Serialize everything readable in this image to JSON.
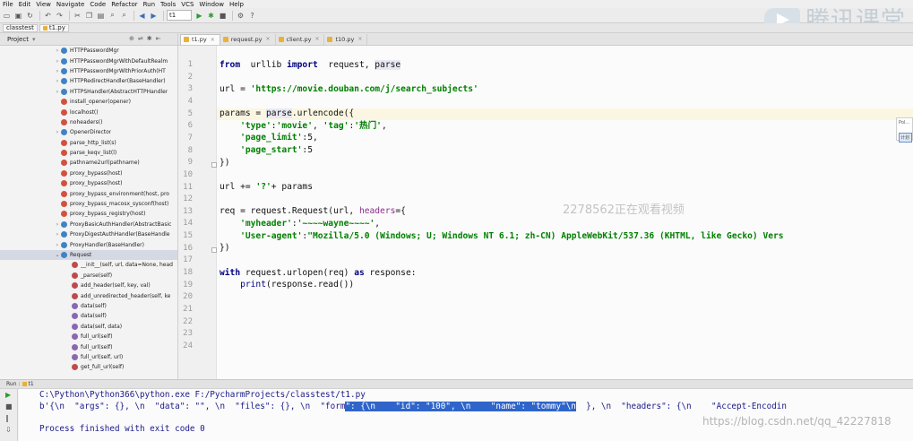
{
  "menu": [
    "File",
    "Edit",
    "View",
    "Navigate",
    "Code",
    "Refactor",
    "Run",
    "Tools",
    "VCS",
    "Window",
    "Help"
  ],
  "toolbar": {
    "run_config": "t1"
  },
  "logo": {
    "text": "腾讯课堂"
  },
  "breadcrumb": [
    "classtest",
    "t1.py"
  ],
  "project": {
    "title": "Project",
    "items": [
      {
        "label": "HTTPPasswordMgr",
        "icon": "class",
        "arrow": "›",
        "indent": 1
      },
      {
        "label": "HTTPPasswordMgrWithDefaultRealm",
        "icon": "class",
        "arrow": "›",
        "indent": 1
      },
      {
        "label": "HTTPPasswordMgrWithPriorAuth(HT",
        "icon": "class",
        "arrow": "›",
        "indent": 1
      },
      {
        "label": "HTTPRedirectHandler(BaseHandler)",
        "icon": "class",
        "arrow": "›",
        "indent": 1
      },
      {
        "label": "HTTPSHandler(AbstractHTTPHandler",
        "icon": "class",
        "arrow": "›",
        "indent": 1
      },
      {
        "label": "install_opener(opener)",
        "icon": "function",
        "arrow": "",
        "indent": 1
      },
      {
        "label": "localhost()",
        "icon": "function",
        "arrow": "",
        "indent": 1
      },
      {
        "label": "noheaders()",
        "icon": "function",
        "arrow": "",
        "indent": 1
      },
      {
        "label": "OpenerDirector",
        "icon": "class",
        "arrow": "›",
        "indent": 1
      },
      {
        "label": "parse_http_list(s)",
        "icon": "function",
        "arrow": "",
        "indent": 1
      },
      {
        "label": "parse_keqv_list(l)",
        "icon": "function",
        "arrow": "",
        "indent": 1
      },
      {
        "label": "pathname2url(pathname)",
        "icon": "function",
        "arrow": "",
        "indent": 1
      },
      {
        "label": "proxy_bypass(host)",
        "icon": "function",
        "arrow": "",
        "indent": 1
      },
      {
        "label": "proxy_bypass(host)",
        "icon": "function",
        "arrow": "",
        "indent": 1
      },
      {
        "label": "proxy_bypass_environment(host, pro",
        "icon": "function",
        "arrow": "",
        "indent": 1
      },
      {
        "label": "proxy_bypass_macosx_sysconf(host)",
        "icon": "function",
        "arrow": "",
        "indent": 1
      },
      {
        "label": "proxy_bypass_registry(host)",
        "icon": "function",
        "arrow": "",
        "indent": 1
      },
      {
        "label": "ProxyBasicAuthHandler(AbstractBasic",
        "icon": "class",
        "arrow": "›",
        "indent": 1
      },
      {
        "label": "ProxyDigestAuthHandler(BaseHandle",
        "icon": "class",
        "arrow": "›",
        "indent": 1
      },
      {
        "label": "ProxyHandler(BaseHandler)",
        "icon": "class",
        "arrow": "›",
        "indent": 1
      },
      {
        "label": "Request",
        "icon": "class",
        "arrow": "⌄",
        "indent": 1,
        "selected": true
      },
      {
        "label": "__init__(self, url, data=None, head",
        "icon": "method",
        "arrow": "",
        "indent": 2
      },
      {
        "label": "_parse(self)",
        "icon": "method",
        "arrow": "",
        "indent": 2
      },
      {
        "label": "add_header(self, key, val)",
        "icon": "method",
        "arrow": "",
        "indent": 2
      },
      {
        "label": "add_unredirected_header(self, ke",
        "icon": "method",
        "arrow": "",
        "indent": 2
      },
      {
        "label": "data(self)",
        "icon": "property",
        "arrow": "",
        "indent": 2
      },
      {
        "label": "data(self)",
        "icon": "property",
        "arrow": "",
        "indent": 2
      },
      {
        "label": "data(self, data)",
        "icon": "property",
        "arrow": "",
        "indent": 2
      },
      {
        "label": "full_url(self)",
        "icon": "property",
        "arrow": "",
        "indent": 2
      },
      {
        "label": "full_url(self)",
        "icon": "property",
        "arrow": "",
        "indent": 2
      },
      {
        "label": "full_url(self, url)",
        "icon": "property",
        "arrow": "",
        "indent": 2
      },
      {
        "label": "get_full_url(self)",
        "icon": "method",
        "arrow": "",
        "indent": 2
      }
    ]
  },
  "tabs": [
    {
      "label": "t1.py",
      "active": true
    },
    {
      "label": "request.py",
      "active": false
    },
    {
      "label": "client.py",
      "active": false
    },
    {
      "label": "t10.py",
      "active": false
    }
  ],
  "editor": {
    "line_numbers": [
      "1",
      "2",
      "3",
      "4",
      "5",
      "6",
      "7",
      "8",
      "9",
      "10",
      "11",
      "12",
      "13",
      "14",
      "15",
      "16",
      "17",
      "18",
      "19",
      "20",
      "21",
      "22",
      "23",
      "24"
    ],
    "current_line": 5,
    "lines": [
      [
        [
          "kw",
          "from"
        ],
        [
          "",
          "  urllib "
        ],
        [
          "kw",
          "import"
        ],
        [
          "",
          "  request, "
        ],
        [
          "hl",
          "parse"
        ]
      ],
      [],
      [
        [
          "",
          "url = "
        ],
        [
          "str",
          "'https://movie.douban.com/j/search_subjects'"
        ]
      ],
      [],
      [
        [
          "",
          "params = "
        ],
        [
          "hl",
          "parse"
        ],
        [
          "",
          ".urlencode({"
        ]
      ],
      [
        [
          "",
          "    "
        ],
        [
          "str",
          "'type'"
        ],
        [
          "",
          ":"
        ],
        [
          "str",
          "'movie'"
        ],
        [
          "",
          ", "
        ],
        [
          "str",
          "'tag'"
        ],
        [
          "",
          ":"
        ],
        [
          "str",
          "'热门'"
        ],
        [
          "",
          ","
        ]
      ],
      [
        [
          "",
          "    "
        ],
        [
          "str",
          "'page_limit'"
        ],
        [
          "",
          ":5,"
        ]
      ],
      [
        [
          "",
          "    "
        ],
        [
          "str",
          "'page_start'"
        ],
        [
          "",
          ":5"
        ]
      ],
      [
        [
          "",
          "})"
        ]
      ],
      [],
      [
        [
          "",
          "url += "
        ],
        [
          "str",
          "'?'"
        ],
        [
          "",
          "+ params"
        ]
      ],
      [],
      [
        [
          "",
          "req = request.Request(url, "
        ],
        [
          "kw2",
          "headers"
        ],
        [
          "",
          "={"
        ]
      ],
      [
        [
          "",
          "    "
        ],
        [
          "str",
          "'myheader'"
        ],
        [
          "",
          ":"
        ],
        [
          "str",
          "'~~~~wayne~~~~'"
        ],
        [
          "",
          ","
        ]
      ],
      [
        [
          "",
          "    "
        ],
        [
          "str",
          "'User-agent'"
        ],
        [
          "",
          ":"
        ],
        [
          "str",
          "\"Mozilla/5.0 (Windows; U; Windows NT 6.1; zh-CN) AppleWebKit/537.36 (KHTML, like Gecko) Vers"
        ]
      ],
      [
        [
          "",
          "})"
        ]
      ],
      [],
      [
        [
          "kw",
          "with"
        ],
        [
          "",
          " request.urlopen(req) "
        ],
        [
          "kw",
          "as"
        ],
        [
          "",
          " response:"
        ]
      ],
      [
        [
          "",
          "    "
        ],
        [
          "bi",
          "print"
        ],
        [
          "",
          "(response.read())"
        ]
      ],
      [],
      [],
      [],
      [],
      []
    ]
  },
  "popup": {
    "line1": "Pol...",
    "line2": "计划"
  },
  "watermark": "2278562正在观看视频",
  "csdn_watermark": "https://blog.csdn.net/qq_42227818",
  "run": {
    "label": "Run",
    "config": "t1",
    "command": "C:\\Python\\Python366\\python.exe F:/PycharmProjects/classtest/t1.py",
    "output_pre": "b'{\\n  \"args\": {}, \\n  \"data\": \"\", \\n  \"files\": {}, \\n  \"form",
    "output_sel": "\": {\\n    \"id\": \"100\", \\n    \"name\": \"tommy\"\\n",
    "output_post": "  }, \\n  \"headers\": {\\n    \"Accept-Encodin",
    "finished": "Process finished with exit code 0"
  }
}
